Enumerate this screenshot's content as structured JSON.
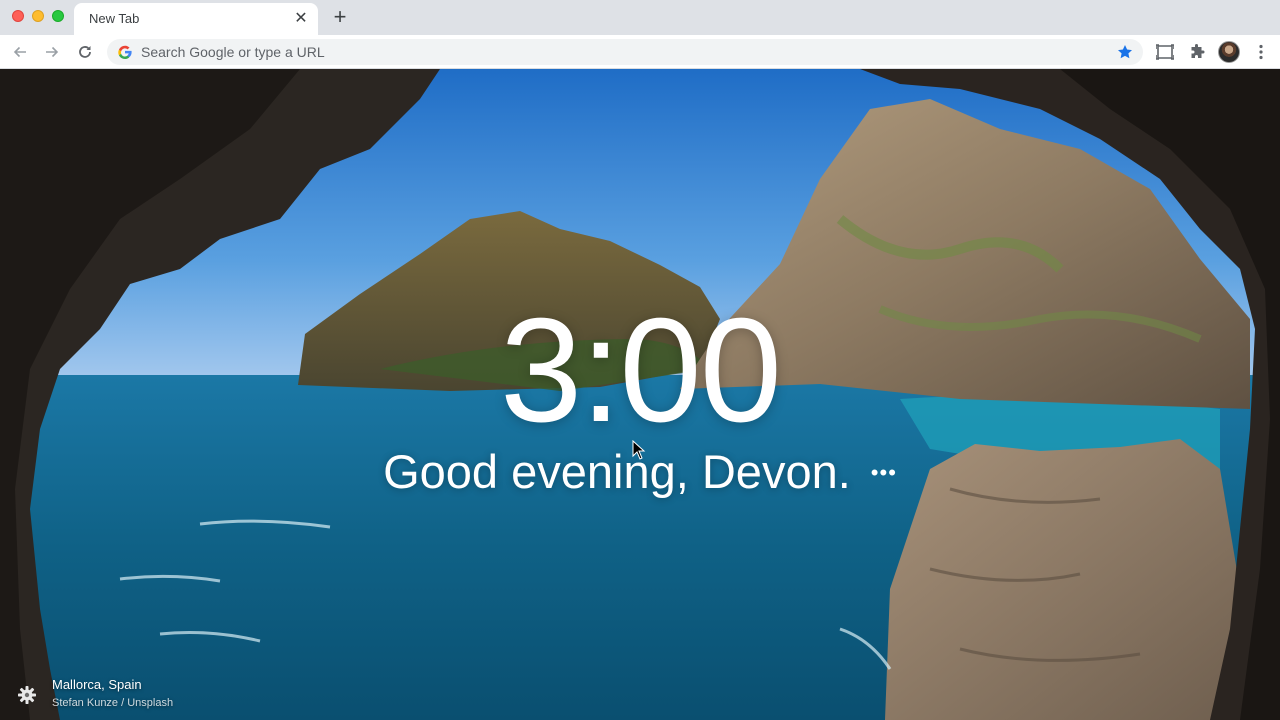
{
  "window": {
    "controls": [
      "close",
      "minimize",
      "zoom"
    ]
  },
  "tabs": [
    {
      "title": "New Tab",
      "active": true
    }
  ],
  "toolbar": {
    "omnibox_placeholder": "Search Google or type a URL",
    "bookmarked": true,
    "icons": [
      "back-arrow-icon",
      "forward-arrow-icon",
      "reload-icon",
      "google-g-icon",
      "star-icon",
      "cast-icon",
      "extensions-puzzle-icon",
      "avatar",
      "kebab-menu-icon"
    ]
  },
  "dashboard": {
    "clock": "3:00",
    "greeting": "Good evening, Devon.",
    "more_label": "•••",
    "location": "Mallorca, Spain",
    "photo_credit": "Stefan Kunze / Unsplash"
  },
  "colors": {
    "tabstrip": "#dee1e6",
    "omnibox": "#f1f3f4",
    "star_blue": "#1a73e8",
    "sky": "#2f7fd0",
    "sea": "#0f6a8a"
  }
}
